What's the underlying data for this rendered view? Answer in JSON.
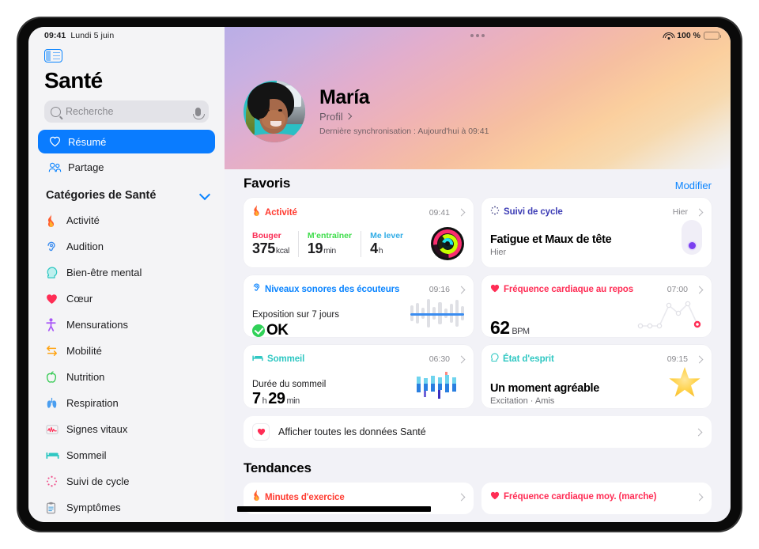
{
  "status_bar": {
    "time": "09:41",
    "date": "Lundi 5 juin",
    "battery_percent": "100 %",
    "wifi_icon": "wifi-icon",
    "battery_icon": "battery-full-icon"
  },
  "sidebar": {
    "toggle_icon": "sidebar-toggle-icon",
    "app_title": "Santé",
    "search": {
      "placeholder": "Recherche",
      "search_icon": "search-icon",
      "mic_icon": "microphone-icon"
    },
    "nav": [
      {
        "label": "Résumé",
        "icon": "heart-outline-icon",
        "glyph": "♥",
        "active": true
      },
      {
        "label": "Partage",
        "icon": "two-people-icon",
        "glyph": "👥",
        "active": false
      }
    ],
    "categories_header": {
      "label": "Catégories de Santé",
      "chevron_icon": "chevron-down-icon"
    },
    "categories": [
      {
        "label": "Activité",
        "icon": "flame-icon",
        "glyph": "🔥"
      },
      {
        "label": "Audition",
        "icon": "ear-icon",
        "glyph": "👂"
      },
      {
        "label": "Bien-être mental",
        "icon": "head-profile-icon",
        "glyph": "🧠"
      },
      {
        "label": "Cœur",
        "icon": "heart-icon",
        "glyph": "❤️"
      },
      {
        "label": "Mensurations",
        "icon": "body-figure-icon",
        "glyph": "🧍"
      },
      {
        "label": "Mobilité",
        "icon": "arrows-icon",
        "glyph": "⇄"
      },
      {
        "label": "Nutrition",
        "icon": "apple-icon",
        "glyph": "🍏"
      },
      {
        "label": "Respiration",
        "icon": "lungs-icon",
        "glyph": "🫁"
      },
      {
        "label": "Signes vitaux",
        "icon": "waveform-icon",
        "glyph": "📈"
      },
      {
        "label": "Sommeil",
        "icon": "bed-icon",
        "glyph": "🛏"
      },
      {
        "label": "Suivi de cycle",
        "icon": "cycle-icon",
        "glyph": "✳"
      },
      {
        "label": "Symptômes",
        "icon": "clipboard-icon",
        "glyph": "📋"
      }
    ]
  },
  "main": {
    "multitask_dots_icon": "multitasking-dots-icon",
    "profile": {
      "avatar_icon": "user-avatar",
      "name": "María",
      "link_label": "Profil",
      "link_chevron_icon": "chevron-right-icon",
      "sync_text": "Dernière synchronisation : Aujourd'hui à 09:41"
    },
    "favorites": {
      "title": "Favoris",
      "edit_label": "Modifier"
    },
    "cards": {
      "activity": {
        "title": "Activité",
        "icon": "flame-icon",
        "title_color": "#ff3b30",
        "time": "09:41",
        "chevron_icon": "chevron-right-icon",
        "metrics": [
          {
            "label": "Bouger",
            "label_color": "#fa2d55",
            "value": "375",
            "unit": "kcal"
          },
          {
            "label": "M'entraîner",
            "label_color": "#3ddc4a",
            "value": "19",
            "unit": "min"
          },
          {
            "label": "Me lever",
            "label_color": "#32ade6",
            "value": "4",
            "unit": "h"
          }
        ],
        "rings_icon": "activity-rings-icon"
      },
      "cycle": {
        "title": "Suivi de cycle",
        "icon": "cycle-icon",
        "title_color": "#ef4f8a",
        "time": "Hier",
        "chevron_icon": "chevron-right-icon",
        "headline": "Fatigue et Maux de tête",
        "sub": "Hier",
        "pill_icon": "cycle-day-indicator"
      },
      "headphones": {
        "title": "Niveaux sonores des écouteurs",
        "icon": "ear-icon",
        "title_color": "#0a84ff",
        "time": "09:16",
        "chevron_icon": "chevron-right-icon",
        "label": "Exposition sur 7 jours",
        "status": "OK",
        "status_icon": "check-circle-icon",
        "chart_icon": "audio-levels-chart"
      },
      "resting_hr": {
        "title": "Fréquence cardiaque au repos",
        "icon": "heart-icon",
        "title_color": "#ff2d55",
        "time": "07:00",
        "chevron_icon": "chevron-right-icon",
        "value": "62",
        "unit": "BPM",
        "chart_icon": "heart-rate-line-chart"
      },
      "sleep": {
        "title": "Sommeil",
        "icon": "bed-icon",
        "title_color": "#2ec7c2",
        "time": "06:30",
        "chevron_icon": "chevron-right-icon",
        "label": "Durée du sommeil",
        "hours": "7",
        "hours_unit": "h",
        "minutes": "29",
        "minutes_unit": "min",
        "chart_icon": "sleep-stages-chart"
      },
      "mood": {
        "title": "État d'esprit",
        "icon": "head-profile-icon",
        "title_color": "#2ec7c2",
        "time": "09:15",
        "chevron_icon": "chevron-right-icon",
        "headline": "Un moment agréable",
        "sub": "Excitation · Amis",
        "star_icon": "mood-star-icon"
      }
    },
    "all_data_row": {
      "label": "Afficher toutes les données Santé",
      "icon": "heart-icon",
      "chevron_icon": "chevron-right-icon"
    },
    "trends": {
      "title": "Tendances",
      "cards": [
        {
          "title": "Minutes d'exercice",
          "icon": "flame-icon",
          "title_color": "#ff3b30",
          "chevron_icon": "chevron-right-icon"
        },
        {
          "title": "Fréquence cardiaque moy. (marche)",
          "icon": "heart-icon",
          "title_color": "#ff2d55",
          "chevron_icon": "chevron-right-icon"
        }
      ]
    }
  }
}
